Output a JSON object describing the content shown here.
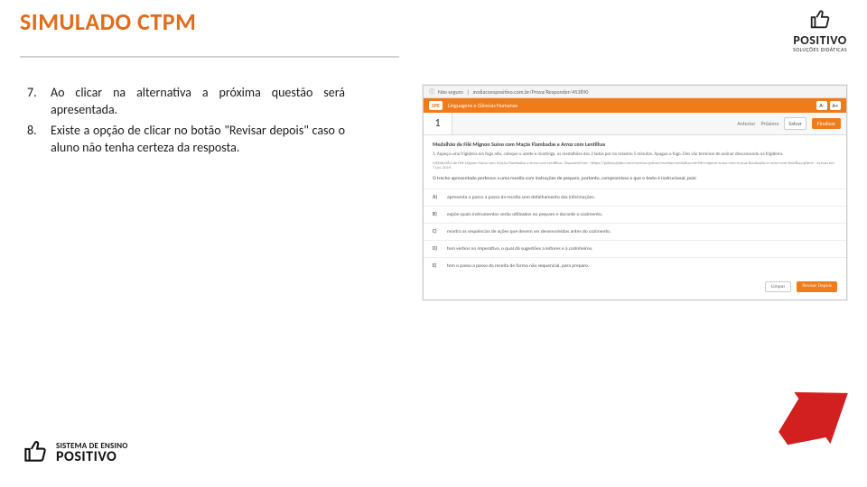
{
  "header": {
    "title": "SIMULADO CTPM"
  },
  "brand": {
    "corner_name": "POSITIVO",
    "corner_sub": "SOLUÇÕES DIDÁTICAS",
    "footer_l1": "SISTEMA DE ENSINO",
    "footer_l2": "POSITIVO"
  },
  "instructions": {
    "step7": "Ao clicar na alternativa a próxima questão será apresentada.",
    "step8": "Existe a opção de clicar no botão \"Revisar depois\" caso o aluno não tenha certeza da resposta."
  },
  "mock": {
    "url_label": "Não seguro",
    "url": "avaliacoespositivo.com.br/Prova/Responder/453890",
    "tag_system": "SPE",
    "tag_area": "Linguagens e Ciências Humanas",
    "zoom_minus": "A-",
    "zoom_plus": "A+",
    "question_number": "1",
    "nav_prev": "Anterior",
    "nav_next": "Próxima",
    "save": "Salvar",
    "finish": "Finalizar",
    "q_title": "Medalhão de Filé Mignon Suíno com Maçãs Flambadas e Arroz com Lentilhas",
    "q_line1": "1. Aqueça uma frigideira em fogo alto, coloque o azeite e manteiga, os medalhões dos 2 lados por no máximo 5 minutos. Apague o fogo. Eles vão terminar de assinar descansando na frigideira.",
    "q_cite": "MEDALHÃO de Filé Mignon Suíno com Maçãs Flambadas e Arroz com Lentilhas. Disponível em: <https://gshow.globo.com/receitas-gshow/receitas/medalhao-de-file-mignon-suino-com-macas-flambadas-e-arroz-com-lentilhas.ghtml>. Acesso em 7 jan. 2019.",
    "q_stem": "O trecho apresentado pertence a uma receita com instruções de preparo, portanto, compromisso o que o texto é instrucional, pois:",
    "alts": {
      "A": "apresenta o passo a passo da receita sem detalhamento das informações.",
      "B": "expõe quais instrumentos serão utilizados no preparo e durante o cozimento.",
      "C": "mostra as sequências de ações que devem ser desenvolvidas antes do cozimento.",
      "D": "tem verbos no imperativo, o qual dá sugestões a leitores e a cozinheiros.",
      "E": "tem o passo a passo da receita de forma não sequencial, para preparo."
    },
    "btn_clear": "Limpar",
    "btn_review": "Revisar Depois"
  }
}
